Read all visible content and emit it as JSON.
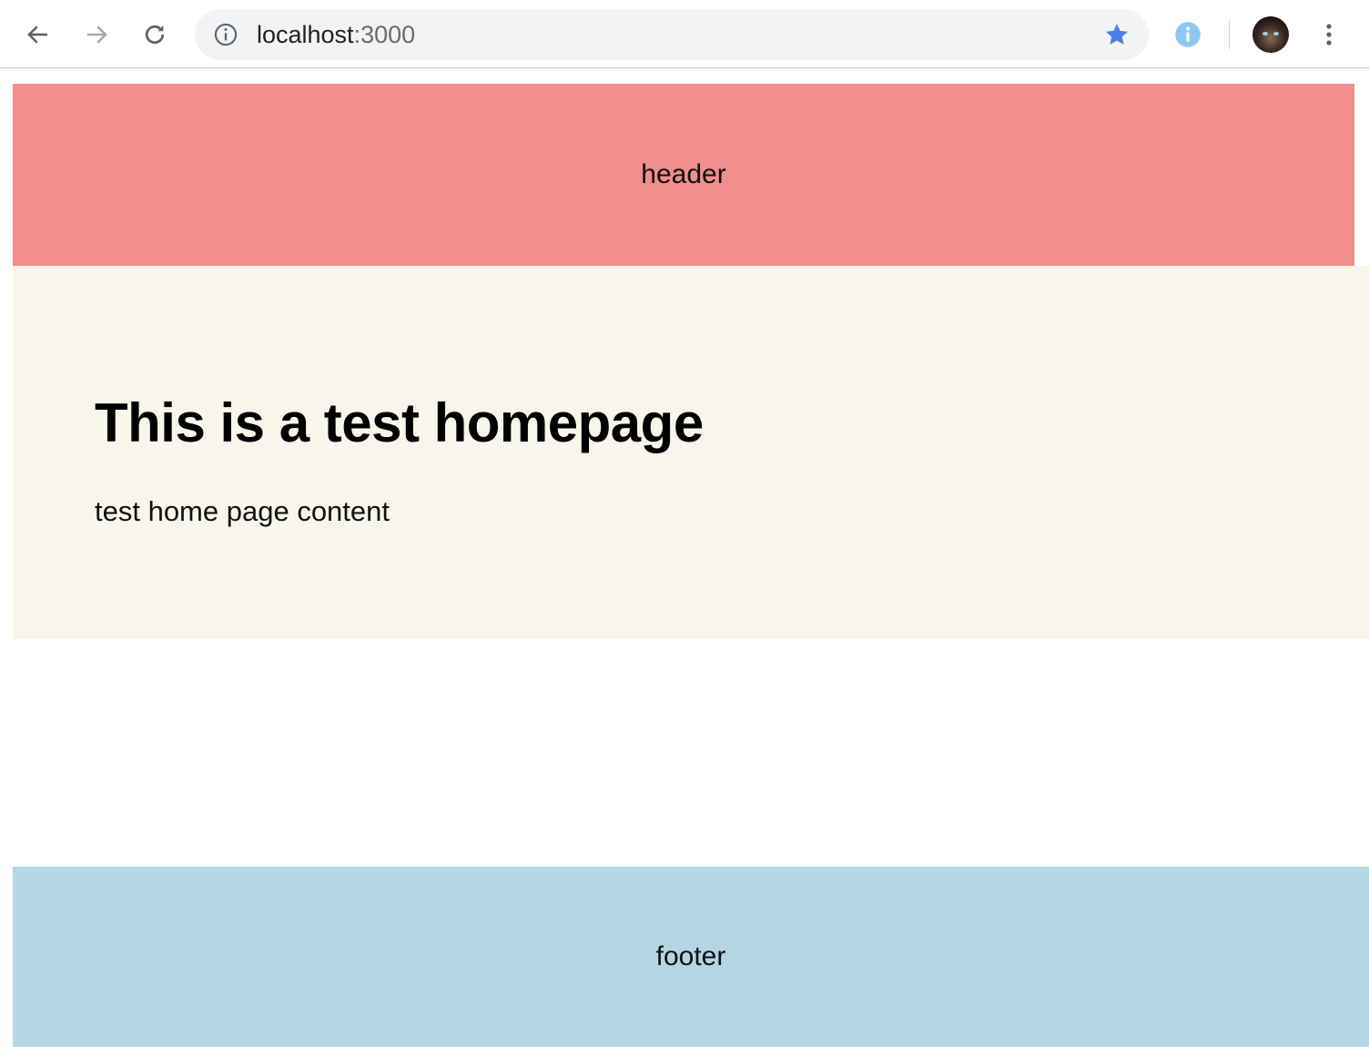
{
  "browser": {
    "url_host": "localhost",
    "url_port": ":3000",
    "icons": {
      "back": "arrow-left-icon",
      "forward": "arrow-right-icon",
      "reload": "reload-icon",
      "site_info": "info-icon",
      "bookmark": "star-icon",
      "extension": "info-circle-icon",
      "menu": "kebab-menu-icon"
    },
    "colors": {
      "star": "#4a7ee8",
      "extension": "#8ec8f2"
    }
  },
  "page": {
    "header_text": "header",
    "title": "This is a test homepage",
    "content": "test home page content",
    "footer_text": "footer",
    "colors": {
      "header_bg": "#f08f8b",
      "main_bg": "#f8f6ea",
      "footer_bg": "#b4d6e2"
    }
  }
}
